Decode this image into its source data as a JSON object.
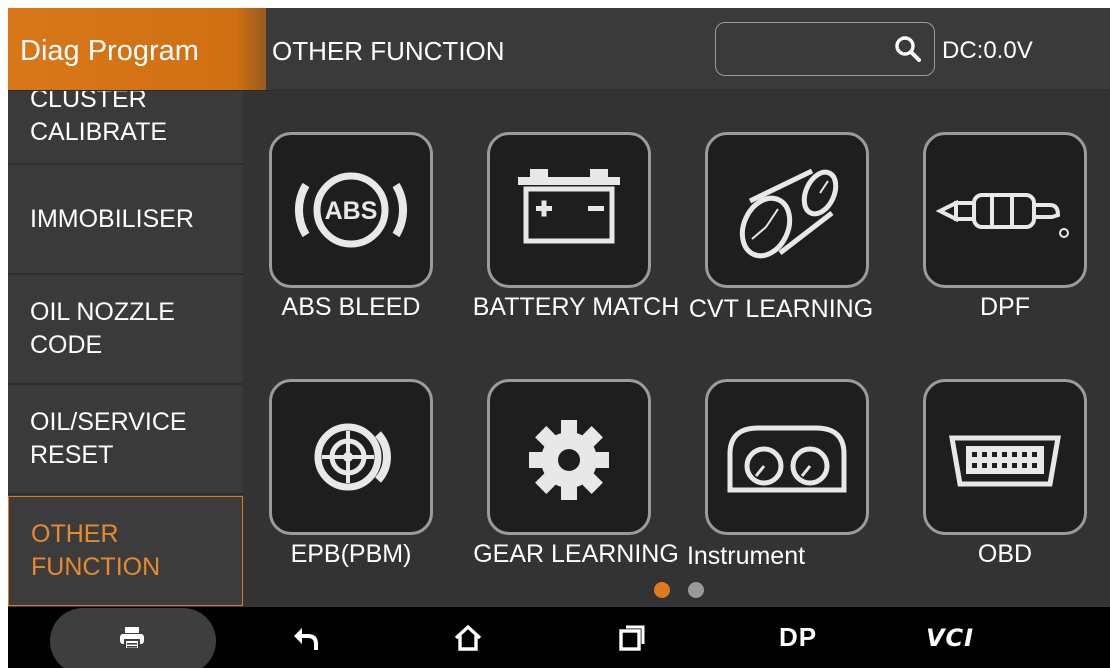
{
  "header": {
    "app_title": "Diag Program",
    "page_title": "OTHER FUNCTION",
    "search": {
      "placeholder": "",
      "icon": "search-icon"
    },
    "dc_voltage": "DC:0.0V",
    "accent_color": "#d9771b"
  },
  "sidebar": {
    "items": [
      {
        "label": "CLUSTER CALIBRATE",
        "active": false
      },
      {
        "label": "IMMOBILISER",
        "active": false
      },
      {
        "label": "OIL NOZZLE CODE",
        "active": false
      },
      {
        "label": "OIL/SERVICE RESET",
        "active": false
      },
      {
        "label": "OTHER FUNCTION",
        "active": true
      }
    ]
  },
  "functions": [
    {
      "label": "ABS BLEED",
      "icon": "abs-icon"
    },
    {
      "label": "BATTERY MATCH",
      "icon": "battery-icon"
    },
    {
      "label": "CVT LEARNING",
      "icon": "cvt-belt-icon"
    },
    {
      "label": "DPF",
      "icon": "dpf-filter-icon"
    },
    {
      "label": "EPB(PBM)",
      "icon": "parking-brake-icon"
    },
    {
      "label": "GEAR LEARNING",
      "icon": "gear-icon"
    },
    {
      "label": "Instrument",
      "icon": "instrument-gauge-icon"
    },
    {
      "label": "OBD",
      "icon": "obd-connector-icon"
    }
  ],
  "pagination": {
    "current_page": 1,
    "total_pages": 2,
    "active_color": "#e07a1c",
    "inactive_color": "#9a9a9a"
  },
  "navbar": {
    "items": [
      {
        "name": "print-icon"
      },
      {
        "name": "back-icon"
      },
      {
        "name": "home-icon"
      },
      {
        "name": "recent-apps-icon"
      },
      {
        "label": "DP"
      },
      {
        "label": "VCI"
      }
    ]
  }
}
